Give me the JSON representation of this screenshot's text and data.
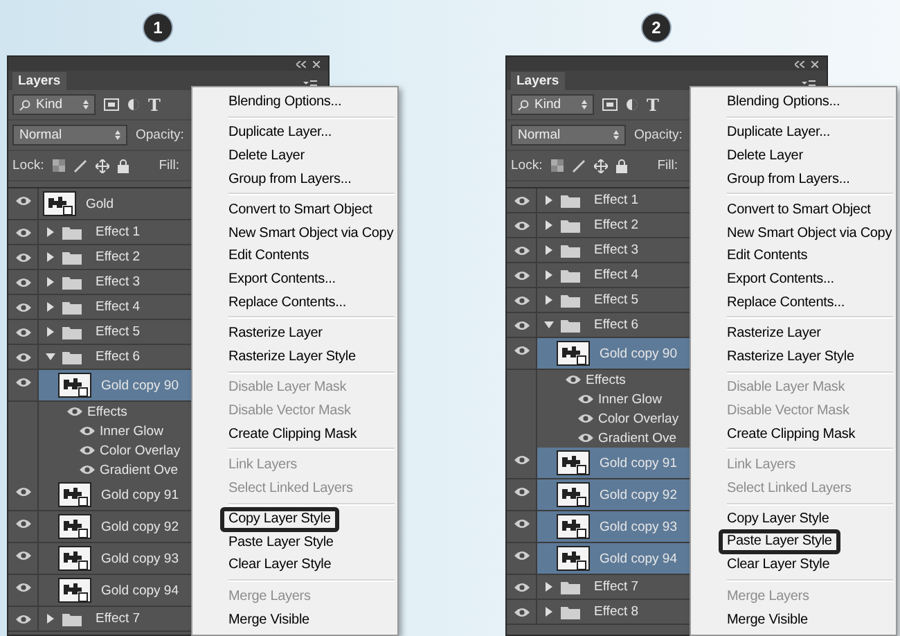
{
  "steps": [
    {
      "number": "1",
      "panel": {
        "tab": "Layers",
        "filter": "Kind",
        "type_filter": "T",
        "blend_mode": "Normal",
        "opacity_label": "Opacity:",
        "lock_label": "Lock:",
        "fill_label": "Fill:",
        "layers": [
          {
            "kind": "layer",
            "name": "Gold",
            "selected": false
          },
          {
            "kind": "group",
            "name": "Effect 1",
            "expanded": false,
            "selected": false
          },
          {
            "kind": "group",
            "name": "Effect 2",
            "expanded": false,
            "selected": false
          },
          {
            "kind": "group",
            "name": "Effect 3",
            "expanded": false,
            "selected": false
          },
          {
            "kind": "group",
            "name": "Effect 4",
            "expanded": false,
            "selected": false
          },
          {
            "kind": "group",
            "name": "Effect 5",
            "expanded": false,
            "selected": false
          },
          {
            "kind": "group",
            "name": "Effect 6",
            "expanded": true,
            "selected": false,
            "children": [
              {
                "kind": "layer",
                "name": "Gold copy 90",
                "selected": true,
                "children": [
                  {
                    "kind": "effects",
                    "name": "Effects",
                    "children": [
                      {
                        "kind": "effect",
                        "name": "Inner Glow"
                      },
                      {
                        "kind": "effect",
                        "name": "Color Overlay"
                      },
                      {
                        "kind": "effect",
                        "name": "Gradient Ove"
                      }
                    ]
                  }
                ]
              },
              {
                "kind": "layer",
                "name": "Gold copy 91",
                "selected": false
              },
              {
                "kind": "layer",
                "name": "Gold copy 92",
                "selected": false
              },
              {
                "kind": "layer",
                "name": "Gold copy 93",
                "selected": false
              },
              {
                "kind": "layer",
                "name": "Gold copy 94",
                "selected": false
              }
            ]
          },
          {
            "kind": "group",
            "name": "Effect 7",
            "expanded": false,
            "selected": false
          }
        ]
      },
      "menu": [
        [
          {
            "label": "Blending Options...",
            "disabled": false,
            "outlined": false
          }
        ],
        [
          {
            "label": "Duplicate Layer...",
            "disabled": false,
            "outlined": false
          },
          {
            "label": "Delete Layer",
            "disabled": false,
            "outlined": false
          },
          {
            "label": "Group from Layers...",
            "disabled": false,
            "outlined": false
          }
        ],
        [
          {
            "label": "Convert to Smart Object",
            "disabled": false,
            "outlined": false
          },
          {
            "label": "New Smart Object via Copy",
            "disabled": false,
            "outlined": false
          },
          {
            "label": "Edit Contents",
            "disabled": false,
            "outlined": false
          },
          {
            "label": "Export Contents...",
            "disabled": false,
            "outlined": false
          },
          {
            "label": "Replace Contents...",
            "disabled": false,
            "outlined": false
          }
        ],
        [
          {
            "label": "Rasterize Layer",
            "disabled": false,
            "outlined": false
          },
          {
            "label": "Rasterize Layer Style",
            "disabled": false,
            "outlined": false
          }
        ],
        [
          {
            "label": "Disable Layer Mask",
            "disabled": true,
            "outlined": false
          },
          {
            "label": "Disable Vector Mask",
            "disabled": true,
            "outlined": false
          },
          {
            "label": "Create Clipping Mask",
            "disabled": false,
            "outlined": false
          }
        ],
        [
          {
            "label": "Link Layers",
            "disabled": true,
            "outlined": false
          },
          {
            "label": "Select Linked Layers",
            "disabled": true,
            "outlined": false
          }
        ],
        [
          {
            "label": "Copy Layer Style",
            "disabled": false,
            "outlined": true
          },
          {
            "label": "Paste Layer Style",
            "disabled": false,
            "outlined": false
          },
          {
            "label": "Clear Layer Style",
            "disabled": false,
            "outlined": false
          }
        ],
        [
          {
            "label": "Merge Layers",
            "disabled": true,
            "outlined": false
          },
          {
            "label": "Merge Visible",
            "disabled": false,
            "outlined": false
          }
        ]
      ]
    },
    {
      "number": "2",
      "panel": {
        "tab": "Layers",
        "filter": "Kind",
        "type_filter": "T",
        "blend_mode": "Normal",
        "opacity_label": "Opacity:",
        "lock_label": "Lock:",
        "fill_label": "Fill:",
        "layers": [
          {
            "kind": "group",
            "name": "Effect 1",
            "expanded": false,
            "selected": false
          },
          {
            "kind": "group",
            "name": "Effect 2",
            "expanded": false,
            "selected": false
          },
          {
            "kind": "group",
            "name": "Effect 3",
            "expanded": false,
            "selected": false
          },
          {
            "kind": "group",
            "name": "Effect 4",
            "expanded": false,
            "selected": false
          },
          {
            "kind": "group",
            "name": "Effect 5",
            "expanded": false,
            "selected": false
          },
          {
            "kind": "group",
            "name": "Effect 6",
            "expanded": true,
            "selected": false,
            "children": [
              {
                "kind": "layer",
                "name": "Gold copy 90",
                "selected": true,
                "children": [
                  {
                    "kind": "effects",
                    "name": "Effects",
                    "children": [
                      {
                        "kind": "effect",
                        "name": "Inner Glow"
                      },
                      {
                        "kind": "effect",
                        "name": "Color Overlay"
                      },
                      {
                        "kind": "effect",
                        "name": "Gradient Ove"
                      }
                    ]
                  }
                ]
              },
              {
                "kind": "layer",
                "name": "Gold copy 91",
                "selected": true
              },
              {
                "kind": "layer",
                "name": "Gold copy 92",
                "selected": true
              },
              {
                "kind": "layer",
                "name": "Gold copy 93",
                "selected": true
              },
              {
                "kind": "layer",
                "name": "Gold copy 94",
                "selected": true
              }
            ]
          },
          {
            "kind": "group",
            "name": "Effect 7",
            "expanded": false,
            "selected": false
          },
          {
            "kind": "group",
            "name": "Effect 8",
            "expanded": false,
            "selected": false
          }
        ]
      },
      "menu": [
        [
          {
            "label": "Blending Options...",
            "disabled": false,
            "outlined": false
          }
        ],
        [
          {
            "label": "Duplicate Layer...",
            "disabled": false,
            "outlined": false
          },
          {
            "label": "Delete Layer",
            "disabled": false,
            "outlined": false
          },
          {
            "label": "Group from Layers...",
            "disabled": false,
            "outlined": false
          }
        ],
        [
          {
            "label": "Convert to Smart Object",
            "disabled": false,
            "outlined": false
          },
          {
            "label": "New Smart Object via Copy",
            "disabled": false,
            "outlined": false
          },
          {
            "label": "Edit Contents",
            "disabled": false,
            "outlined": false
          },
          {
            "label": "Export Contents...",
            "disabled": false,
            "outlined": false
          },
          {
            "label": "Replace Contents...",
            "disabled": false,
            "outlined": false
          }
        ],
        [
          {
            "label": "Rasterize Layer",
            "disabled": false,
            "outlined": false
          },
          {
            "label": "Rasterize Layer Style",
            "disabled": false,
            "outlined": false
          }
        ],
        [
          {
            "label": "Disable Layer Mask",
            "disabled": true,
            "outlined": false
          },
          {
            "label": "Disable Vector Mask",
            "disabled": true,
            "outlined": false
          },
          {
            "label": "Create Clipping Mask",
            "disabled": false,
            "outlined": false
          }
        ],
        [
          {
            "label": "Link Layers",
            "disabled": true,
            "outlined": false
          },
          {
            "label": "Select Linked Layers",
            "disabled": true,
            "outlined": false
          }
        ],
        [
          {
            "label": "Copy Layer Style",
            "disabled": false,
            "outlined": false
          },
          {
            "label": "Paste Layer Style",
            "disabled": false,
            "outlined": true
          },
          {
            "label": "Clear Layer Style",
            "disabled": false,
            "outlined": false
          }
        ],
        [
          {
            "label": "Merge Layers",
            "disabled": true,
            "outlined": false
          },
          {
            "label": "Merge Visible",
            "disabled": false,
            "outlined": false
          }
        ]
      ]
    }
  ]
}
